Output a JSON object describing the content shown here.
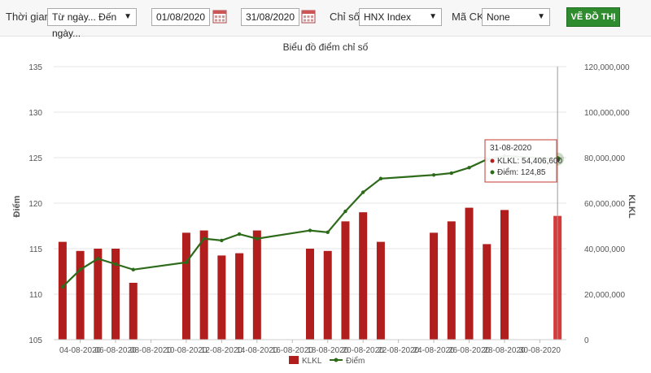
{
  "toolbar": {
    "period_label": "Thời gian",
    "period_value": "Từ ngày... Đến ngày...",
    "from_date": "01/08/2020",
    "to_date": "31/08/2020",
    "index_label": "Chỉ số",
    "index_value": "HNX Index",
    "code_label": "Mã CK",
    "code_value": "None",
    "draw_button": "VẼ ĐỒ THỊ"
  },
  "colors": {
    "bar": "#b01e1e",
    "bar_highlight": "#d63a3a",
    "line": "#2d6b1a",
    "button": "#2e8b2e"
  },
  "chart_data": {
    "type": "bar",
    "title": "Biểu đồ điểm chỉ số",
    "ylabel_left": "Điểm",
    "ylabel_right": "KLKL",
    "ylim_left": [
      105,
      135
    ],
    "ylim_right": [
      0,
      120000000
    ],
    "yticks_left": [
      "135",
      "130",
      "125",
      "120",
      "115",
      "110",
      "105"
    ],
    "yticks_right": [
      "120,000,000",
      "100,000,000",
      "80,000,000",
      "60,000,000",
      "40,000,000",
      "20,000,000",
      "0"
    ],
    "xticks": [
      "04-08-2020",
      "06-08-2020",
      "08-08-2020",
      "10-08-2020",
      "12-08-2020",
      "14-08-2020",
      "16-08-2020",
      "18-08-2020",
      "20-08-2020",
      "22-08-2020",
      "24-08-2020",
      "26-08-2020",
      "28-08-2020",
      "30-08-2020"
    ],
    "dates": [
      "03-08-2020",
      "04-08-2020",
      "05-08-2020",
      "06-08-2020",
      "07-08-2020",
      "10-08-2020",
      "11-08-2020",
      "12-08-2020",
      "13-08-2020",
      "14-08-2020",
      "17-08-2020",
      "18-08-2020",
      "19-08-2020",
      "20-08-2020",
      "21-08-2020",
      "24-08-2020",
      "25-08-2020",
      "26-08-2020",
      "27-08-2020",
      "28-08-2020",
      "31-08-2020"
    ],
    "series": [
      {
        "name": "KLKL",
        "type": "bar",
        "axis": "right",
        "values": [
          43000000,
          39000000,
          40000000,
          40000000,
          25000000,
          47000000,
          48000000,
          37000000,
          38000000,
          48000000,
          40000000,
          39000000,
          52000000,
          56000000,
          43000000,
          47000000,
          52000000,
          58000000,
          42000000,
          57000000,
          54406600
        ]
      },
      {
        "name": "Điểm",
        "type": "line",
        "axis": "left",
        "values": [
          110.8,
          112.7,
          113.9,
          113.3,
          112.7,
          113.5,
          116.1,
          115.9,
          116.6,
          116.1,
          117.0,
          116.8,
          119.1,
          121.2,
          122.7,
          123.1,
          123.3,
          123.9,
          124.8,
          125.2,
          124.85
        ]
      }
    ],
    "legend": [
      "KLKL",
      "Điểm"
    ],
    "legend_position": "bottom",
    "tooltip": {
      "date": "31-08-2020",
      "klkl_label": "KLKL",
      "klkl_value": "54,406,600",
      "diem_label": "Điểm",
      "diem_value": "124,85"
    }
  }
}
